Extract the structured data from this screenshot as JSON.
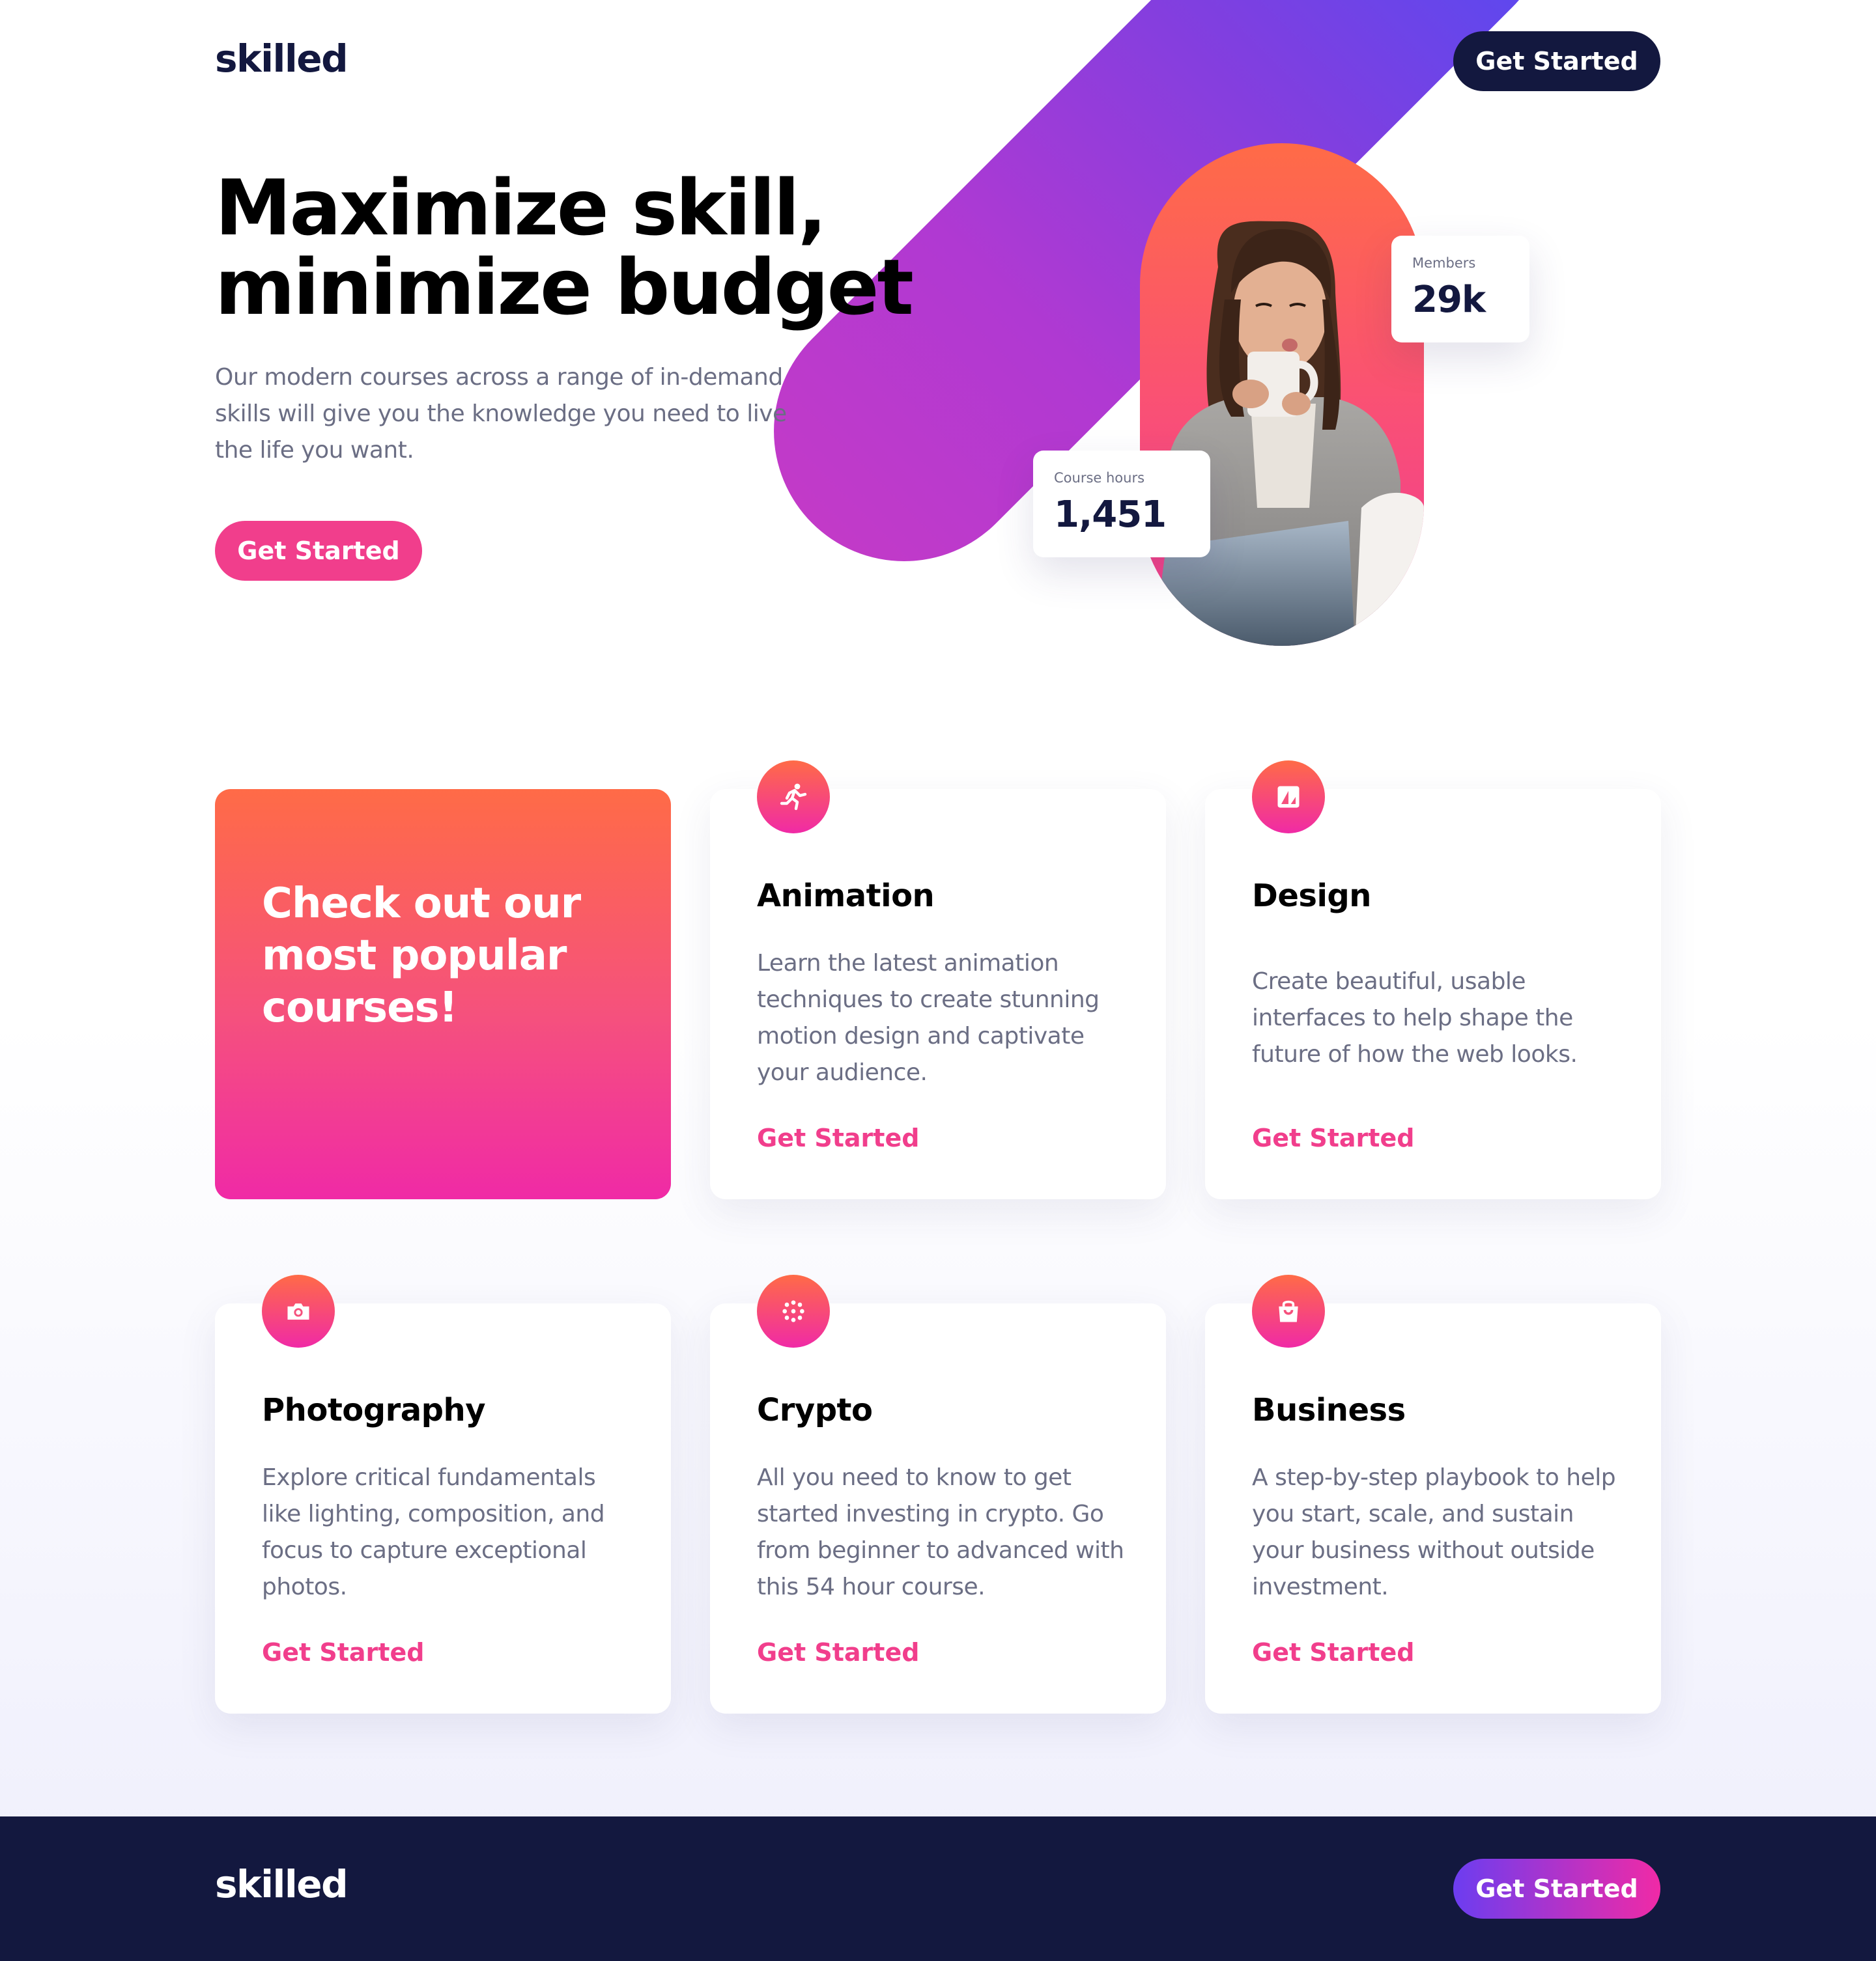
{
  "header": {
    "logo": "skilled",
    "cta_label": "Get Started"
  },
  "hero": {
    "title_line1": "Maximize skill,",
    "title_line2": "minimize budget",
    "description": "Our modern courses across a range of in-demand skills will give you the knowledge you need to live the life you want.",
    "cta_label": "Get Started",
    "stats": {
      "members_label": "Members",
      "members_value": "29k",
      "hours_label": "Course hours",
      "hours_value": "1,451"
    }
  },
  "courses": {
    "promo_title": "Check out our most popular courses!",
    "items": [
      {
        "icon": "running-figure-icon",
        "title": "Animation",
        "description": "Learn the latest animation techniques to create stunning motion design and captivate your audience.",
        "link": "Get Started"
      },
      {
        "icon": "design-frame-icon",
        "title": "Design",
        "description": "Create beautiful, usable interfaces to help shape the future of how the web looks.",
        "link": "Get Started"
      },
      {
        "icon": "camera-icon",
        "title": "Photography",
        "description": "Explore critical fundamentals like lighting, composition, and focus to capture exceptional photos.",
        "link": "Get Started"
      },
      {
        "icon": "crypto-dots-icon",
        "title": "Crypto",
        "description": "All you need to know to get started investing in crypto. Go from beginner to advanced with this 54 hour course.",
        "link": "Get Started"
      },
      {
        "icon": "shopping-bag-icon",
        "title": "Business",
        "description": "A step-by-step playbook to help you start, scale, and sustain your business without outside investment.",
        "link": "Get Started"
      }
    ]
  },
  "footer": {
    "logo": "skilled",
    "cta_label": "Get Started"
  },
  "colors": {
    "navy": "#13183f",
    "pink": "#f13e8c",
    "orange": "#ff6b47",
    "magenta": "#f02aa6",
    "purple": "#4e4cf5",
    "text_gray": "#6b6e84"
  }
}
